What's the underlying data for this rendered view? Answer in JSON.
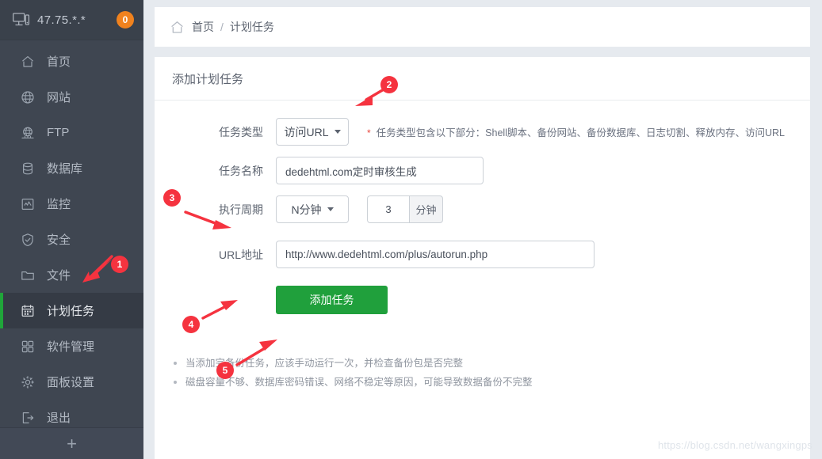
{
  "sidebar": {
    "host": "47.75.*.*",
    "badge": "0",
    "monitor_icon": "monitor-icon",
    "add_label": "+",
    "items": [
      {
        "label": "首页",
        "icon": "home-icon",
        "active": false
      },
      {
        "label": "网站",
        "icon": "globe-icon",
        "active": false
      },
      {
        "label": "FTP",
        "icon": "ftp-icon",
        "active": false
      },
      {
        "label": "数据库",
        "icon": "database-icon",
        "active": false
      },
      {
        "label": "监控",
        "icon": "monitor-chart-icon",
        "active": false
      },
      {
        "label": "安全",
        "icon": "shield-icon",
        "active": false
      },
      {
        "label": "文件",
        "icon": "folder-icon",
        "active": false
      },
      {
        "label": "计划任务",
        "icon": "calendar-icon",
        "active": true
      },
      {
        "label": "软件管理",
        "icon": "grid-icon",
        "active": false
      },
      {
        "label": "面板设置",
        "icon": "gear-icon",
        "active": false
      },
      {
        "label": "退出",
        "icon": "logout-icon",
        "active": false
      }
    ]
  },
  "breadcrumb": {
    "home_icon": "home-icon",
    "home": "首页",
    "separator": "/",
    "current": "计划任务"
  },
  "panel": {
    "title": "添加计划任务",
    "form": {
      "task_type": {
        "label": "任务类型",
        "value": "访问URL",
        "hint_star": "*",
        "hint": "任务类型包含以下部分：Shell脚本、备份网站、备份数据库、日志切割、释放内存、访问URL"
      },
      "task_name": {
        "label": "任务名称",
        "value": "dedehtml.com定时审核生成",
        "placeholder": "任务名称"
      },
      "period": {
        "label": "执行周期",
        "value": "N分钟",
        "number": "3",
        "unit": "分钟"
      },
      "url": {
        "label": "URL地址",
        "value": "http://www.dedehtml.com/plus/autorun.php",
        "placeholder": "URL地址"
      },
      "submit_label": "添加任务"
    },
    "notes": [
      "当添加完备份任务，应该手动运行一次，并检查备份包是否完整",
      "磁盘容量不够、数据库密码错误、网络不稳定等原因，可能导致数据备份不完整"
    ]
  },
  "annotations": [
    {
      "number": "1"
    },
    {
      "number": "2"
    },
    {
      "number": "3"
    },
    {
      "number": "4"
    },
    {
      "number": "5"
    }
  ],
  "watermark": "https://blog.csdn.net/wangxingps",
  "colors": {
    "sidebar_bg": "#3f4651",
    "active_accent": "#20a53a",
    "badge": "#f0821e",
    "submit_green": "#20a03c",
    "annotation_red": "#f5333f",
    "page_bg": "#e6eaef"
  }
}
